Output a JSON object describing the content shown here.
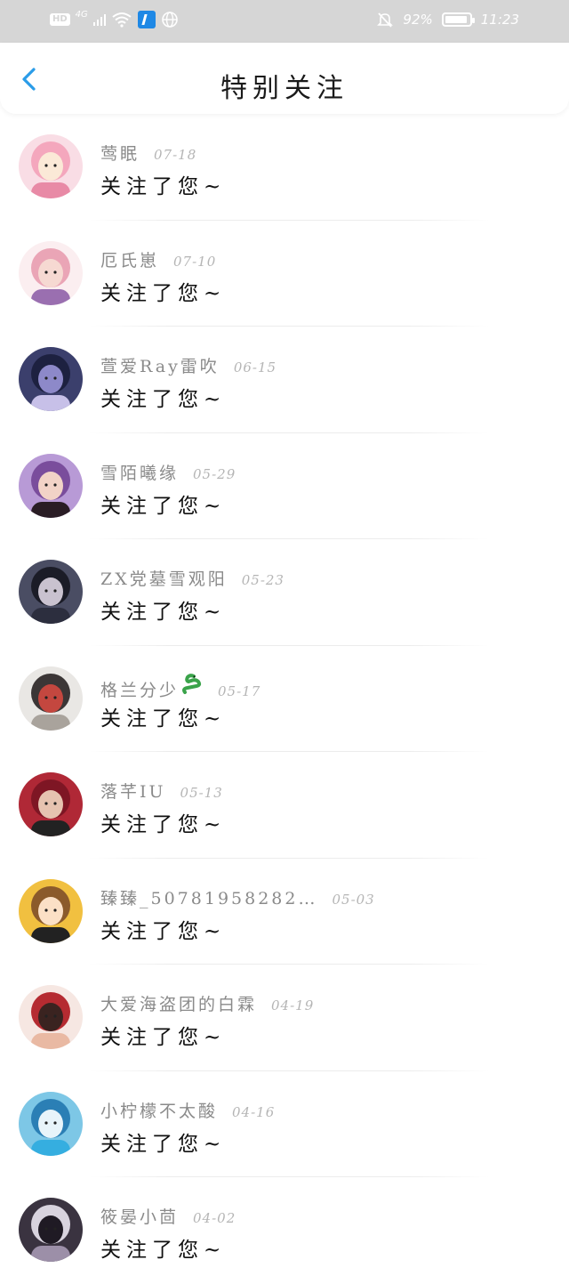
{
  "status_bar": {
    "hd": "HD",
    "network": "4G",
    "battery_text": "92%",
    "battery_level": 0.92,
    "time": "11:23"
  },
  "header": {
    "title": "特别关注"
  },
  "colors": {
    "accent": "#2a9ce8",
    "status_bar_bg": "#d6d6d6",
    "name_gray": "#8a8a8a",
    "date_gray": "#b5b5b5"
  },
  "items": [
    {
      "name": "莺眠",
      "date": "07-18",
      "message": "关注了您~",
      "avatar_icon": "avatar-pink-anime-girl"
    },
    {
      "name": "厄氏崽",
      "date": "07-10",
      "message": "关注了您~",
      "avatar_icon": "avatar-pink-hair-girl"
    },
    {
      "name": "萱爱Ray雷吹",
      "date": "06-15",
      "message": "关注了您~",
      "avatar_icon": "avatar-dark-anime-boy"
    },
    {
      "name": "雪陌曦缘",
      "date": "05-29",
      "message": "关注了您~",
      "avatar_icon": "avatar-selfie-girl"
    },
    {
      "name": "ZX党墓雪观阳",
      "date": "05-23",
      "message": "关注了您~",
      "avatar_icon": "avatar-dark-anime-girl"
    },
    {
      "name": "格兰分少",
      "name_emoji": "🐍",
      "date": "05-17",
      "message": "关注了您~",
      "avatar_icon": "avatar-scooter-boy"
    },
    {
      "name": "落芊IU",
      "date": "05-13",
      "message": "关注了您~",
      "avatar_icon": "avatar-red-bg-boy"
    },
    {
      "name": "臻臻_50781958282…",
      "date": "05-03",
      "message": "关注了您~",
      "avatar_icon": "avatar-cartoon-glasses"
    },
    {
      "name": "大爱海盗团的白霖",
      "date": "04-19",
      "message": "关注了您~",
      "avatar_icon": "avatar-red-kimono-girl"
    },
    {
      "name": "小柠檬不太酸",
      "date": "04-16",
      "message": "关注了您~",
      "avatar_icon": "avatar-blue-hair-girl"
    },
    {
      "name": "筱晏小茴",
      "date": "04-02",
      "message": "关注了您~",
      "avatar_icon": "avatar-hooded-girl"
    }
  ]
}
